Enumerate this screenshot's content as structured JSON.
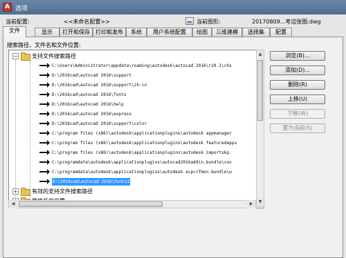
{
  "window": {
    "title": "选项",
    "title_icon_glyph": "A"
  },
  "header": {
    "current_config_label": "当前配置:",
    "current_config_value": "<<未命名配置>>",
    "current_drawing_label": "当前图形:",
    "current_drawing_value": "20170809...考边张图.dwg"
  },
  "tabs": [
    "文件",
    "显示",
    "打开和保存",
    "打印和发布",
    "系统",
    "用户系统配置",
    "绘图",
    "三维建模",
    "选择集",
    "配置"
  ],
  "active_tab": "文件",
  "panel": {
    "caption": "搜索路径、文件名和文件位置:",
    "tree": {
      "root_label": "支持文件搜索路径",
      "paths": [
        "C:\\Users\\Administrator\\appdata\\roaming\\autodesk\\autocad 2016\\r20.1\\chs",
        "D:\\2016cad\\autocad 2016\\support",
        "D:\\2016cad\\autocad 2016\\support\\zh-cn",
        "D:\\2016cad\\autocad 2016\\fonts",
        "D:\\2016cad\\autocad 2016\\help",
        "D:\\2016cad\\autocad 2016\\express",
        "D:\\2016cad\\autocad 2016\\support\\color",
        "C:\\program files (x86)\\autodesk\\applicationplugins\\autodesk appmanager",
        "C:\\program files (x86)\\autodesk\\applicationplugins\\autodesk featuredapps",
        "C:\\program files (x86)\\autodesk\\applicationplugins\\autodesk importskp.",
        "C:\\programdata\\autodesk\\applicationplugins\\autocad2016addin.bundle\\con",
        "C:\\programdata\\autodesk\\applicationplugins\\autodesk acpcrfmon.bundle\\w",
        "D:\\2016cad\\autocad 2016\\fonts1"
      ],
      "selected_path": "D:\\2016cad\\autocad 2016\\fonts1",
      "sibling_nodes": [
        "有效的支持文件搜索路径",
        "受信任的位置"
      ]
    }
  },
  "buttons": [
    {
      "label": "浏览(B)...",
      "enabled": true
    },
    {
      "label": "添加(D)...",
      "enabled": true
    },
    {
      "label": "删除(R)",
      "enabled": true
    },
    {
      "label": "上移(U)",
      "enabled": true
    },
    {
      "label": "下移(W)",
      "enabled": false
    },
    {
      "label": "置为当前(S)",
      "enabled": false
    }
  ],
  "colors": {
    "selection": "#3399ff",
    "titlebar": "#4e6d93"
  }
}
